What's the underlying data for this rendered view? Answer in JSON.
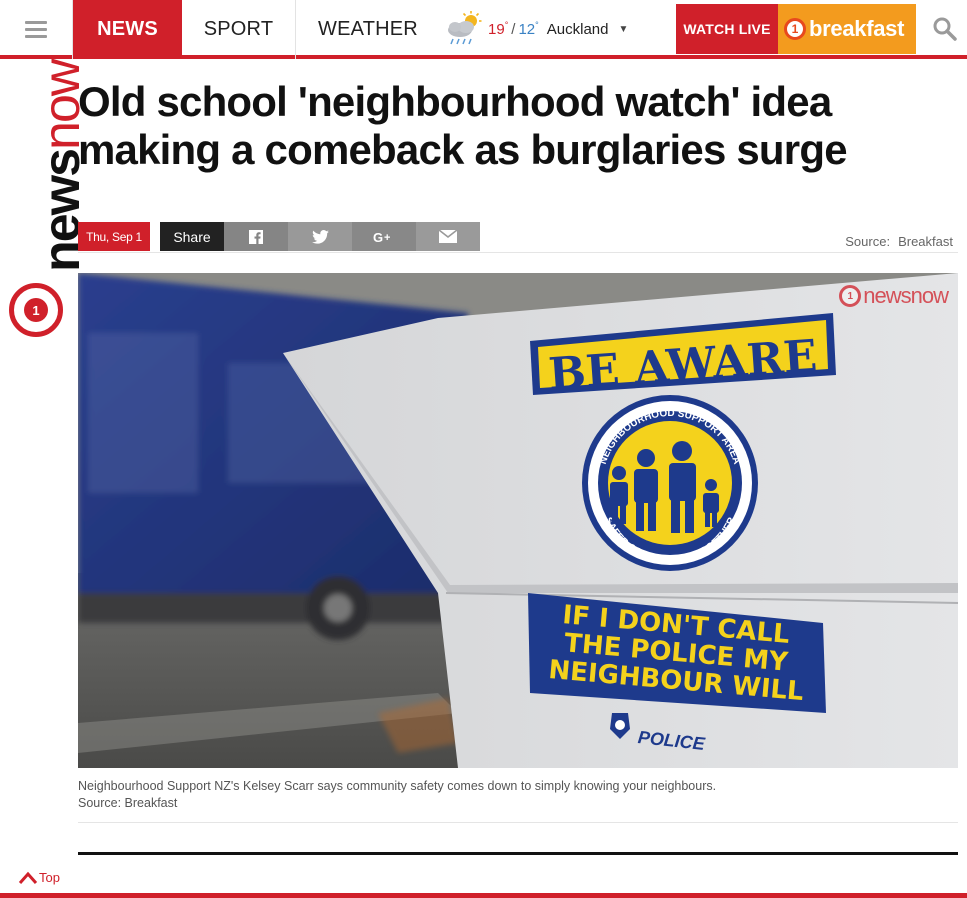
{
  "nav": {
    "items": [
      "NEWS",
      "SPORT",
      "WEATHER"
    ],
    "weather": {
      "high": "19",
      "low": "12",
      "degree": "°",
      "city": "Auckland"
    },
    "watch_live": "WATCH LIVE",
    "breakfast_badge": "1",
    "breakfast": "breakfast"
  },
  "brand": {
    "news": "news",
    "now": "now",
    "badge": "1"
  },
  "article": {
    "headline": "Old school 'neighbourhood watch' idea making a comeback as burglaries surge",
    "date": "Thu, Sep 1",
    "share_label": "Share",
    "source_label": "Source:",
    "source_value": "Breakfast",
    "caption": "Neighbourhood Support NZ's Kelsey Scarr says community safety comes down to simply knowing your neighbours.",
    "caption_source": "Source: Breakfast"
  },
  "hero": {
    "watermark_badge": "1",
    "watermark": "newsnow",
    "sign_top": "BE AWARE",
    "seal_top": "NEIGHBOURHOOD SUPPORT AREA",
    "seal_bottom": "SAFER COMMUNITIES TOGETHER",
    "sign_bottom_1": "IF I DON'T CALL",
    "sign_bottom_2": "THE POLICE MY",
    "sign_bottom_3": "NEIGHBOUR WILL",
    "police": "POLICE"
  },
  "footer": {
    "top_link": "Top"
  },
  "colors": {
    "brand_red": "#d0202a",
    "breakfast_orange": "#f39b1e",
    "sign_blue": "#1e3a8c",
    "sign_yellow": "#f4d21c"
  },
  "icons": [
    "menu-icon",
    "weather-cloud-rain-sun-icon",
    "chevron-down-icon",
    "search-icon",
    "facebook-icon",
    "twitter-icon",
    "google-plus-icon",
    "email-icon",
    "chevron-up-icon"
  ]
}
